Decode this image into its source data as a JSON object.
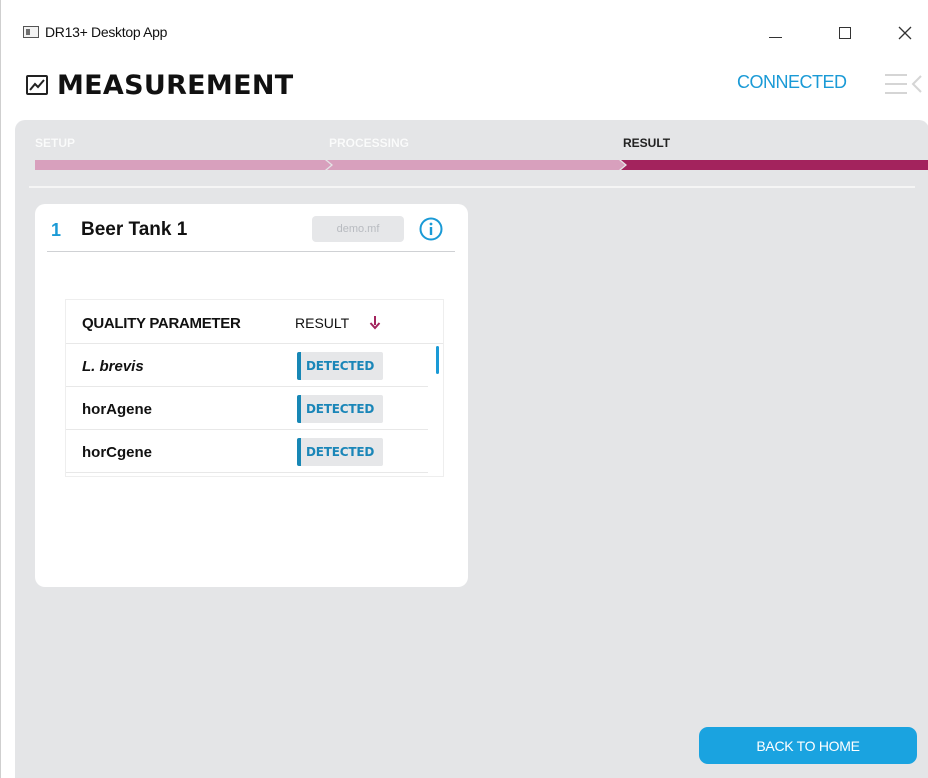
{
  "window": {
    "title": "DR13+ Desktop App"
  },
  "header": {
    "title": "MEASUREMENT",
    "connection_status": "CONNECTED"
  },
  "stepper": {
    "steps": [
      {
        "label": "SETUP",
        "state": "done"
      },
      {
        "label": "PROCESSING",
        "state": "done"
      },
      {
        "label": "RESULT",
        "state": "active"
      }
    ],
    "colors": {
      "done": "#d8a0bd",
      "active": "#a3235d"
    }
  },
  "card": {
    "index": "1",
    "name": "Beer Tank 1",
    "file": "demo.mf",
    "table": {
      "col_param": "QUALITY PARAMETER",
      "col_result": "RESULT",
      "rows": [
        {
          "parameter": "L. brevis",
          "result": "DETECTED"
        },
        {
          "parameter": "horAgene",
          "result": "DETECTED"
        },
        {
          "parameter": "horCgene",
          "result": "DETECTED"
        }
      ]
    }
  },
  "footer": {
    "back_label": "BACK TO HOME"
  },
  "colors": {
    "accent": "#1a9ad6",
    "panel_bg": "#e4e5e7",
    "step_done": "#d8a0bd",
    "step_active": "#a3235d"
  },
  "icons": [
    "app-icon",
    "minimize-icon",
    "maximize-icon",
    "close-icon",
    "chart-icon",
    "menu-icon",
    "info-icon",
    "sort-arrow-down-icon"
  ]
}
